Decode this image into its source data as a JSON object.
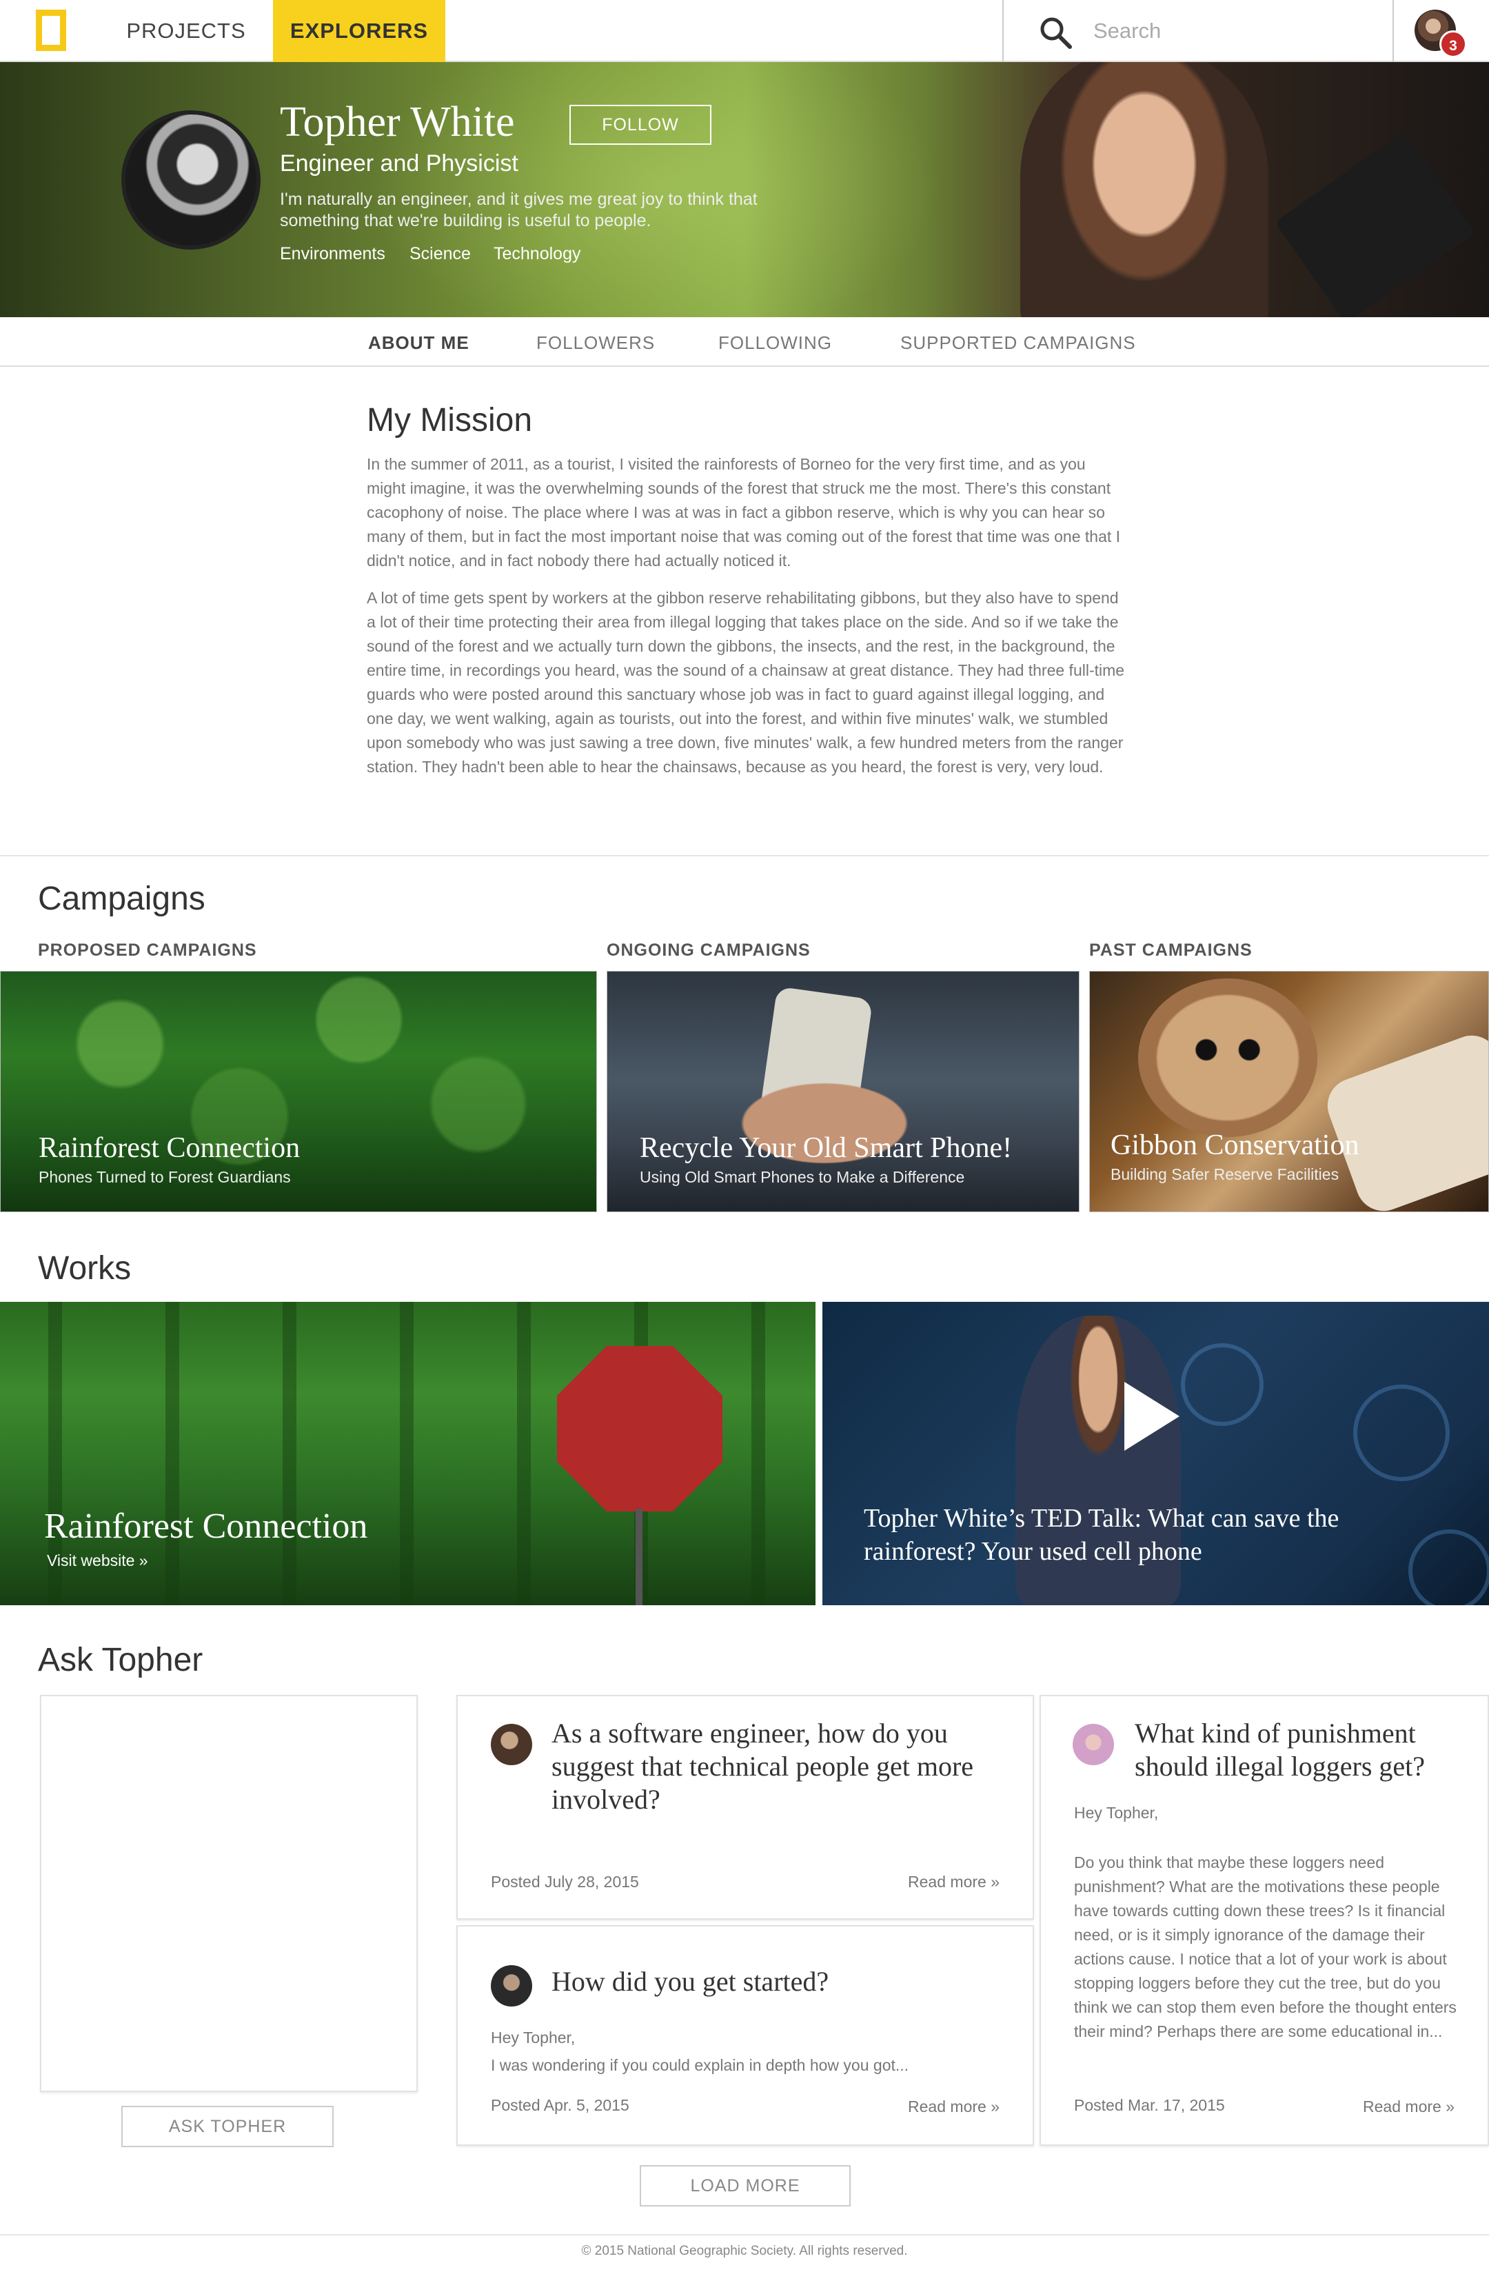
{
  "nav": {
    "projects": "PROJECTS",
    "explorers": "EXPLORERS",
    "search_placeholder": "Search",
    "notification_count": "3",
    "accent_color": "#f8d11e"
  },
  "profile": {
    "name": "Topher White",
    "follow_label": "FOLLOW",
    "subtitle": "Engineer and Physicist",
    "bio": "I'm naturally an engineer, and it gives me great joy to think that something that we're building is useful to people.",
    "tags": [
      "Environments",
      "Science",
      "Technology"
    ]
  },
  "tabs": [
    "ABOUT ME",
    "FOLLOWERS",
    "FOLLOWING",
    "SUPPORTED CAMPAIGNS"
  ],
  "mission": {
    "title": "My Mission",
    "paragraphs": [
      "In the summer of 2011, as a tourist, I visited the rainforests of Borneo for the very first time, and as you might imagine, it was the overwhelming sounds of the forest that struck me the most. There's this constant cacophony of noise. The place where I was at was in fact a gibbon reserve, which is why you can hear so many of them, but in fact the most important noise that was coming out of the forest that time was one that I didn't notice, and in fact nobody there had actually noticed it.",
      "A lot of time gets spent by workers at the gibbon reserve rehabilitating gibbons, but they also have to spend a lot of their time protecting their area from illegal logging that takes place on the side. And so if we take the sound of the forest and we actually turn down the gibbons, the insects, and the rest, in the background, the entire time, in recordings you heard, was the sound of a chainsaw at great distance. They had three full-time guards who were posted around this sanctuary whose job was in fact to guard against illegal logging, and one day, we went walking, again as tourists, out into the forest, and within five minutes' walk, we stumbled upon somebody who was just sawing a tree down, five minutes' walk, a few hundred meters from the ranger station. They hadn't been able to hear the chainsaws, because as you heard, the forest is very, very loud."
    ]
  },
  "campaigns": {
    "title": "Campaigns",
    "columns": [
      {
        "label": "PROPOSED CAMPAIGNS",
        "title": "Rainforest Connection",
        "subtitle": "Phones Turned to Forest Guardians"
      },
      {
        "label": "ONGOING CAMPAIGNS",
        "title": "Recycle Your Old Smart Phone!",
        "subtitle": "Using Old Smart Phones to Make a Difference"
      },
      {
        "label": "PAST CAMPAIGNS",
        "title": "Gibbon Conservation",
        "subtitle": "Building Safer Reserve Facilities"
      }
    ]
  },
  "works": {
    "title": "Works",
    "items": [
      {
        "title": "Rainforest Connection",
        "link": "Visit website »"
      },
      {
        "title": "Topher White’s TED Talk: What can save the rainforest? Your used cell phone"
      }
    ]
  },
  "ask": {
    "title": "Ask Topher",
    "button": "ASK TOPHER",
    "load_more": "LOAD MORE",
    "questions": [
      {
        "title": "As a software engineer, how do you suggest that technical people get more involved?",
        "date": "Posted July 28, 2015",
        "read_more": "Read more »"
      },
      {
        "title": "How did you get started?",
        "greeting": "Hey Topher,",
        "body": "I was wondering if you could explain in depth how you got...",
        "date": "Posted Apr. 5, 2015",
        "read_more": "Read more »"
      },
      {
        "title": "What kind of punishment should illegal loggers get?",
        "greeting": "Hey Topher,",
        "body": "Do you think that maybe these loggers need punishment? What are the motivations these people have towards cutting down these trees? Is it financial need, or is it simply ignorance of the damage their actions cause. I notice that a lot of your work is about stopping loggers before they cut the tree, but do you think we can stop them even before the thought enters their mind? Perhaps there are some educational in...",
        "date": "Posted Mar. 17, 2015",
        "read_more": "Read more »"
      }
    ]
  },
  "footer": "© 2015 National Geographic Society. All rights reserved."
}
